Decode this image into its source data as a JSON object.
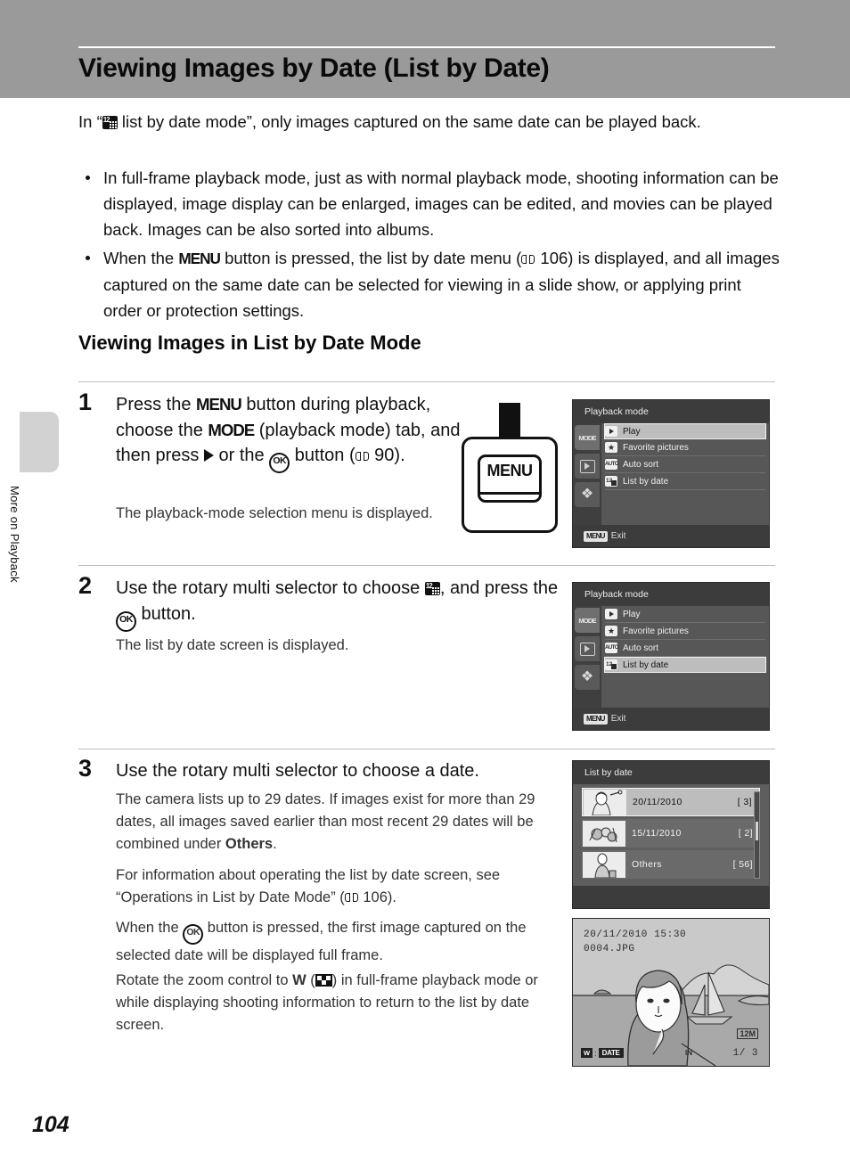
{
  "page": {
    "title": "Viewing Images by Date (List by Date)",
    "number": "104",
    "side_label": "More on Playback"
  },
  "intro": {
    "before": "In “",
    "icon": "list-by-date-icon",
    "after": " list by date mode”, only images captured on the same date can be played back."
  },
  "bullets": [
    {
      "text": "In full-frame playback mode, just as with normal playback mode, shooting information can be displayed, image display can be enlarged, images can be edited, and movies can be played back. Images can be also sorted into albums."
    },
    {
      "pre": "When the ",
      "menu_word": "MENU",
      "mid": " button is pressed, the list by date menu (",
      "ref": " 106",
      "post": ") is displayed, and all images captured on the same date can be selected for viewing in a slide show, or applying print order or protection settings."
    }
  ],
  "section_title": "Viewing Images in List by Date Mode",
  "steps": [
    {
      "number": "1",
      "head_a": "Press the ",
      "head_menu": "MENU",
      "head_b": " button during playback, choose the ",
      "head_mode": "MODE",
      "head_c": " (playback mode) tab, and then press ",
      "head_d": " or the ",
      "head_ok": "OK",
      "head_e": " button (",
      "head_ref": " 90",
      "head_f": ").",
      "sub": "The playback-mode selection menu is displayed."
    },
    {
      "number": "2",
      "head_a": "Use the rotary multi selector to choose ",
      "head_b": ", and press the ",
      "head_ok": "OK",
      "head_c": " button.",
      "sub": "The list by date screen is displayed."
    },
    {
      "number": "3",
      "head": "Use the rotary multi selector to choose a date.",
      "para1_a": "The camera lists up to 29 dates. If images exist for more than 29 dates, all images saved earlier than most recent 29 dates will be combined under ",
      "para1_bold": "Others",
      "para1_b": ".",
      "para2": "For information about operating the list by date screen, see “Operations in List by Date Mode” (",
      "para2_ref": " 106",
      "para2_end": ").",
      "para3_a": "When the ",
      "para3_ok": "OK",
      "para3_b": " button is pressed, the first image captured on the selected date will be displayed full frame.",
      "para4_a": "Rotate the zoom control to ",
      "para4_w": "W",
      "para4_b": " (",
      "para4_c": ") in full-frame playback mode or while displaying shooting information to return to the list by date screen."
    }
  ],
  "menu_illustration": {
    "button_label": "MENU"
  },
  "screens": {
    "playback_mode_1": {
      "title": "Playback mode",
      "tabs": [
        {
          "name": "mode-tab",
          "label": "MODE"
        },
        {
          "name": "playback-tab",
          "label": ""
        },
        {
          "name": "setup-tab",
          "label": "⚒"
        }
      ],
      "items": [
        {
          "label": "Play",
          "icon": "play-icon",
          "selected": true
        },
        {
          "label": "Favorite pictures",
          "icon": "star-icon",
          "selected": false
        },
        {
          "label": "Auto sort",
          "icon": "auto-icon",
          "selected": false
        },
        {
          "label": "List by date",
          "icon": "date-icon",
          "selected": false
        }
      ],
      "footer_chip": "MENU",
      "footer_label": "Exit"
    },
    "playback_mode_2": {
      "title": "Playback mode",
      "tabs": [
        {
          "name": "mode-tab",
          "label": "MODE"
        },
        {
          "name": "playback-tab",
          "label": ""
        },
        {
          "name": "setup-tab",
          "label": "⚒"
        }
      ],
      "items": [
        {
          "label": "Play",
          "icon": "play-icon",
          "selected": false
        },
        {
          "label": "Favorite pictures",
          "icon": "star-icon",
          "selected": false
        },
        {
          "label": "Auto sort",
          "icon": "auto-icon",
          "selected": false
        },
        {
          "label": "List by date",
          "icon": "date-icon",
          "selected": true
        }
      ],
      "footer_chip": "MENU",
      "footer_label": "Exit"
    },
    "list_by_date": {
      "title": "List by date",
      "rows": [
        {
          "date": "20/11/2010",
          "count": "[    3]",
          "selected": true
        },
        {
          "date": "15/11/2010",
          "count": "[    2]",
          "selected": false
        },
        {
          "date": "Others",
          "count": "[  56]",
          "selected": false
        }
      ]
    },
    "full_frame": {
      "date": "20/11/2010 15:30",
      "filename": "0004.JPG",
      "w_chip": "W",
      "w_separator": ":",
      "date_chip": "DATE",
      "memory": "IN",
      "counter": "1/  3",
      "image_size": "12M"
    }
  }
}
